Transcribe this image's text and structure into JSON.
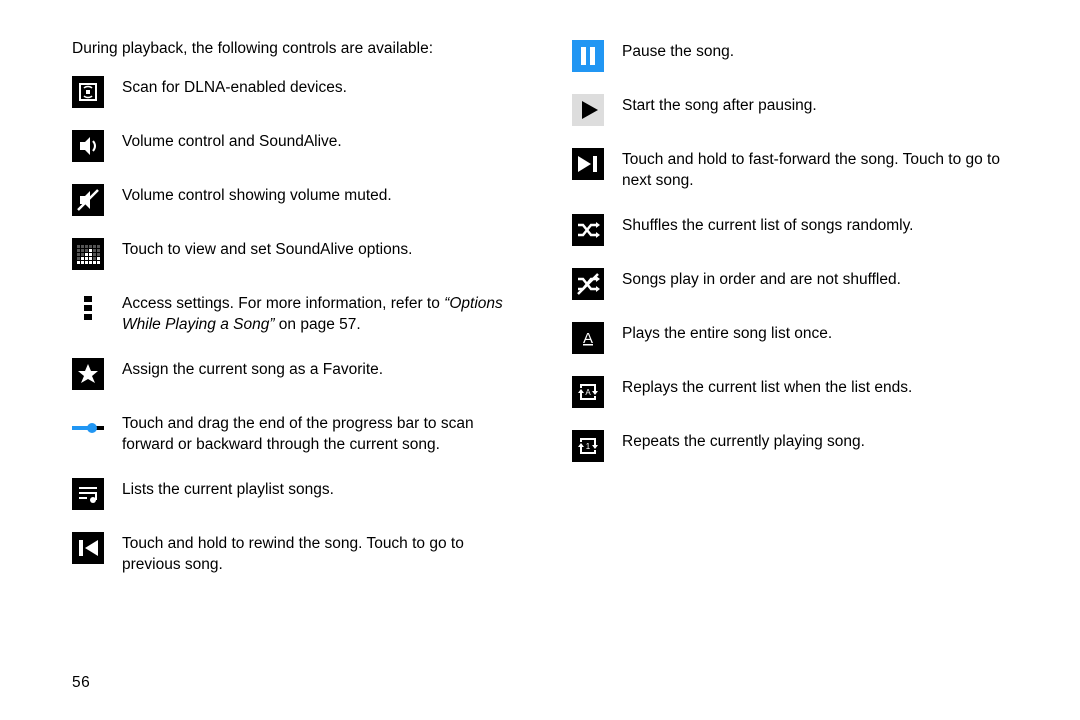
{
  "intro": "During playback, the following controls are available:",
  "page_number": "56",
  "left": [
    {
      "icon": "dlna",
      "text": "Scan for DLNA-enabled devices."
    },
    {
      "icon": "volume",
      "text": "Volume control and SoundAlive."
    },
    {
      "icon": "volume-muted",
      "text": "Volume control showing volume muted."
    },
    {
      "icon": "equalizer",
      "text": "Touch to view and set SoundAlive options."
    },
    {
      "icon": "menu-dots",
      "text": "Access settings. For more information, refer to ",
      "italic": "“Options While Playing a Song”",
      "suffix": " on page 57."
    },
    {
      "icon": "star",
      "text": "Assign the current song as a Favorite."
    },
    {
      "icon": "progress",
      "text": "Touch and drag the end of the progress bar to scan forward or backward through the current song."
    },
    {
      "icon": "playlist",
      "text": "Lists the current playlist songs."
    },
    {
      "icon": "prev",
      "text": "Touch and hold to rewind the song. Touch to go to previous song."
    }
  ],
  "right": [
    {
      "icon": "pause",
      "text": "Pause the song."
    },
    {
      "icon": "play",
      "text": "Start the song after pausing."
    },
    {
      "icon": "next",
      "text": "Touch and hold to fast-forward the song. Touch to go to next song."
    },
    {
      "icon": "shuffle",
      "text": "Shuffles the current list of songs randomly."
    },
    {
      "icon": "no-shuffle",
      "text": "Songs play in order and are not shuffled."
    },
    {
      "icon": "play-once",
      "text": "Plays the entire song list once."
    },
    {
      "icon": "repeat-list",
      "text": "Replays the current list when the list ends."
    },
    {
      "icon": "repeat-one",
      "text": "Repeats the currently playing song."
    }
  ]
}
